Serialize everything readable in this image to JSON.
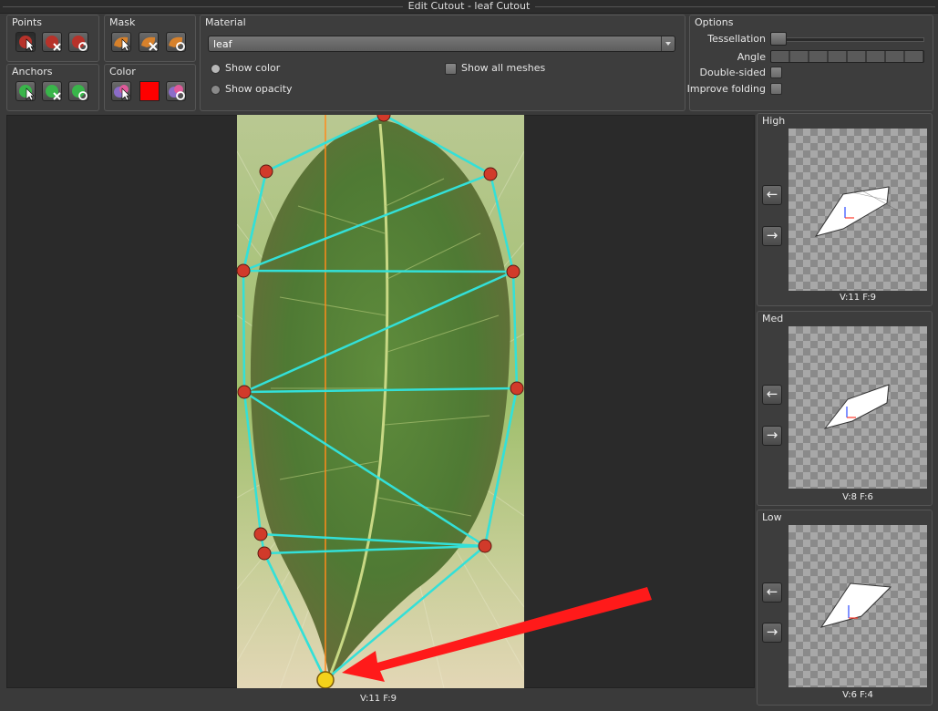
{
  "window": {
    "title": "Edit Cutout - leaf Cutout"
  },
  "points": {
    "label": "Points",
    "tools": [
      "point-select-icon",
      "point-delete-icon",
      "point-reset-icon"
    ]
  },
  "mask": {
    "label": "Mask",
    "tools": [
      "mask-select-icon",
      "mask-delete-icon",
      "mask-reset-icon"
    ]
  },
  "anchors": {
    "label": "Anchors",
    "tools": [
      "anchor-select-icon",
      "anchor-delete-icon",
      "anchor-reset-icon"
    ]
  },
  "color": {
    "label": "Color",
    "swatch": "#ff0000",
    "tools": [
      "color-picker-icon",
      "color-swatch",
      "color-reset-icon"
    ]
  },
  "material": {
    "label": "Material",
    "selected": "leaf",
    "show_color": "Show color",
    "show_opacity": "Show opacity",
    "show_all_meshes": "Show all  meshes",
    "show_color_selected": true
  },
  "options": {
    "label": "Options",
    "tessellation": "Tessellation",
    "angle": "Angle",
    "double_sided": "Double-sided",
    "improve_folding": "Improve folding",
    "tessellation_value": 0.0
  },
  "viewport": {
    "stats": "V:11  F:9"
  },
  "lods": [
    {
      "label": "High",
      "stats": "V:11  F:9"
    },
    {
      "label": "Med",
      "stats": "V:8  F:6"
    },
    {
      "label": "Low",
      "stats": "V:6  F:4"
    }
  ],
  "colors": {
    "accent_mesh": "#33e0d8",
    "point": "#d13a2a",
    "anchor": "#f3d21a",
    "arrow": "#ff1a1a",
    "axis": "#ff8a1a"
  }
}
